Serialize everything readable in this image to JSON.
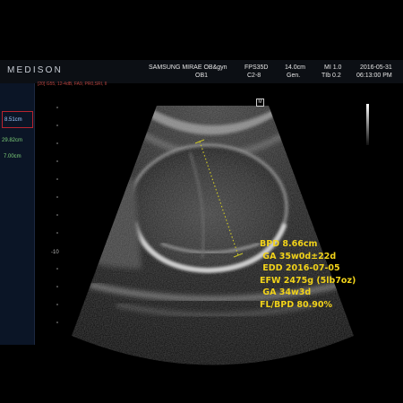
{
  "header": {
    "brand": "MEDISON",
    "model": "SAMSUNG MIRAE OB&gyn",
    "operator": "OB1",
    "fps": "FPS35D",
    "probe": "C2-8",
    "depth": "14.0cm",
    "mode": "Gen.",
    "mi": "MI 1.0",
    "tib": "TIb 0.2",
    "date": "2016-05-31",
    "time": "06:13:00 PM"
  },
  "imaging_params": "[20] G55, 12-4dB, FA9, PR0,SRI, II",
  "left_panel": {
    "measurements": [
      "8.51cm",
      "29.82cm",
      "7.00cm"
    ]
  },
  "depth_marker": "-10",
  "probe_marker": "M",
  "results": [
    "BPD 8.66cm",
    " GA 35w0d±22d",
    " EDD 2016-07-05",
    "EFW 2475g (5lb7oz)",
    " GA 34w3d",
    "FL/BPD 80.90%"
  ],
  "colors": {
    "results_text": "#f2d31a",
    "caliper": "#c8c227",
    "params_text": "#b8433e",
    "meas_green": "#7fd17a",
    "meas_selected": "#9ecbff"
  }
}
